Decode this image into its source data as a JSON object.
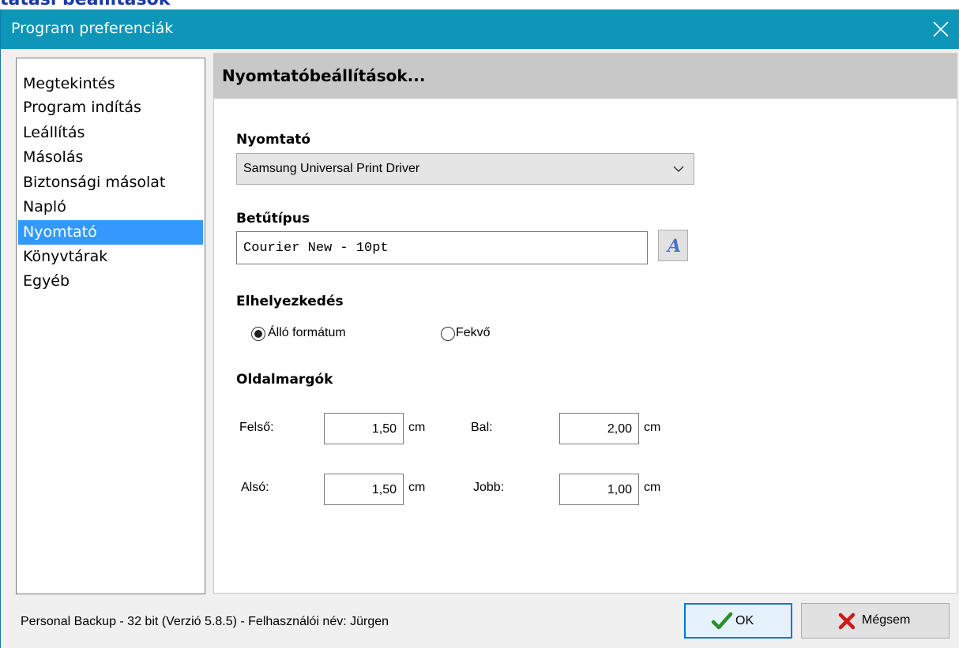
{
  "background_title": "tatási beállítások",
  "window": {
    "title": "Program preferenciák"
  },
  "nav": {
    "items": [
      {
        "label": "Megtekintés"
      },
      {
        "label": "Program indítás"
      },
      {
        "label": "Leállítás"
      },
      {
        "label": "Másolás"
      },
      {
        "label": "Biztonsági másolat"
      },
      {
        "label": "Napló"
      },
      {
        "label": "Nyomtató",
        "selected": true
      },
      {
        "label": "Könyvtárak"
      },
      {
        "label": "Egyéb"
      }
    ]
  },
  "panel": {
    "title": "Nyomtatóbeállítások...",
    "printer": {
      "label": "Nyomtató",
      "selected": "Samsung Universal Print Driver"
    },
    "font": {
      "label": "Betűtípus",
      "value": "Courier New - 10pt"
    },
    "orientation": {
      "label": "Elhelyezkedés",
      "options": [
        {
          "label": "Álló formátum",
          "checked": true
        },
        {
          "label": "Fekvő",
          "checked": false
        }
      ]
    },
    "margins": {
      "label": "Oldalmargók",
      "top": {
        "label": "Felső:",
        "value": "1,50",
        "unit": "cm"
      },
      "left": {
        "label": "Bal:",
        "value": "2,00",
        "unit": "cm"
      },
      "bottom": {
        "label": "Alsó:",
        "value": "1,50",
        "unit": "cm"
      },
      "right": {
        "label": "Jobb:",
        "value": "1,00",
        "unit": "cm"
      }
    }
  },
  "status": "Personal Backup - 32 bit (Verzió 5.8.5) - Felhasználói név: Jürgen",
  "buttons": {
    "ok": "OK",
    "cancel": "Mégsem"
  },
  "colors": {
    "titlebar": "#0d96b8",
    "selection": "#3399ff",
    "header_bg": "#c8c8c8"
  },
  "icons": [
    "close-icon",
    "chevron-down-icon",
    "font-icon",
    "checkmark-icon",
    "cross-icon"
  ]
}
